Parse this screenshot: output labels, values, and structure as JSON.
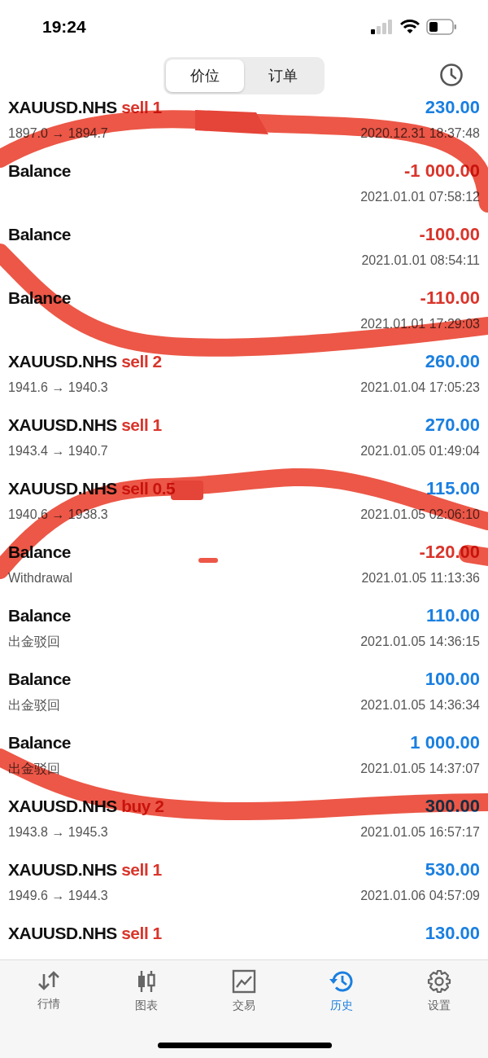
{
  "status_bar": {
    "time": "19:24"
  },
  "tabs": [
    {
      "label": "价位",
      "selected": true
    },
    {
      "label": "订单",
      "selected": false
    }
  ],
  "rows": [
    {
      "kind": "trade",
      "symbol": "XAUUSD.NHS",
      "action": "sell 1",
      "prices": "1897.0 → 1894.7",
      "amount": "230.00",
      "negative": false,
      "time": "2020.12.31 18:37:48"
    },
    {
      "kind": "balance",
      "title": "Balance",
      "amount": "-1 000.00",
      "negative": true,
      "time": "2021.01.01 07:58:12"
    },
    {
      "kind": "balance",
      "title": "Balance",
      "amount": "-100.00",
      "negative": true,
      "time": "2021.01.01 08:54:11"
    },
    {
      "kind": "balance",
      "title": "Balance",
      "amount": "-110.00",
      "negative": true,
      "time": "2021.01.01 17:29:03"
    },
    {
      "kind": "trade",
      "symbol": "XAUUSD.NHS",
      "action": "sell 2",
      "prices": "1941.6 → 1940.3",
      "amount": "260.00",
      "negative": false,
      "time": "2021.01.04 17:05:23"
    },
    {
      "kind": "trade",
      "symbol": "XAUUSD.NHS",
      "action": "sell 1",
      "prices": "1943.4 → 1940.7",
      "amount": "270.00",
      "negative": false,
      "time": "2021.01.05 01:49:04"
    },
    {
      "kind": "trade",
      "symbol": "XAUUSD.NHS",
      "action": "sell 0.5",
      "prices": "1940.6 → 1938.3",
      "amount": "115.00",
      "negative": false,
      "time": "2021.01.05 02:06:10"
    },
    {
      "kind": "balance",
      "title": "Balance",
      "comment": "Withdrawal",
      "amount": "-120.00",
      "negative": true,
      "time": "2021.01.05 11:13:36"
    },
    {
      "kind": "balance",
      "title": "Balance",
      "comment": "出金驳回",
      "amount": "110.00",
      "negative": false,
      "time": "2021.01.05 14:36:15"
    },
    {
      "kind": "balance",
      "title": "Balance",
      "comment": "出金驳回",
      "amount": "100.00",
      "negative": false,
      "time": "2021.01.05 14:36:34"
    },
    {
      "kind": "balance",
      "title": "Balance",
      "comment": "出金驳回",
      "amount": "1 000.00",
      "negative": false,
      "time": "2021.01.05 14:37:07"
    },
    {
      "kind": "trade",
      "symbol": "XAUUSD.NHS",
      "action": "buy 2",
      "prices": "1943.8 → 1945.3",
      "amount": "300.00",
      "negative": false,
      "time": "2021.01.05 16:57:17"
    },
    {
      "kind": "trade",
      "symbol": "XAUUSD.NHS",
      "action": "sell 1",
      "prices": "1949.6 → 1944.3",
      "amount": "530.00",
      "negative": false,
      "time": "2021.01.06 04:57:09"
    },
    {
      "kind": "trade",
      "symbol": "XAUUSD.NHS",
      "action": "sell 1",
      "amount": "130.00",
      "negative": false
    }
  ],
  "nav": [
    {
      "kind": "quotes",
      "label": "行情",
      "selected": false
    },
    {
      "kind": "chart",
      "label": "图表",
      "selected": false
    },
    {
      "kind": "trade",
      "label": "交易",
      "selected": false
    },
    {
      "kind": "history",
      "label": "历史",
      "selected": true
    },
    {
      "kind": "settings",
      "label": "设置",
      "selected": false
    }
  ]
}
